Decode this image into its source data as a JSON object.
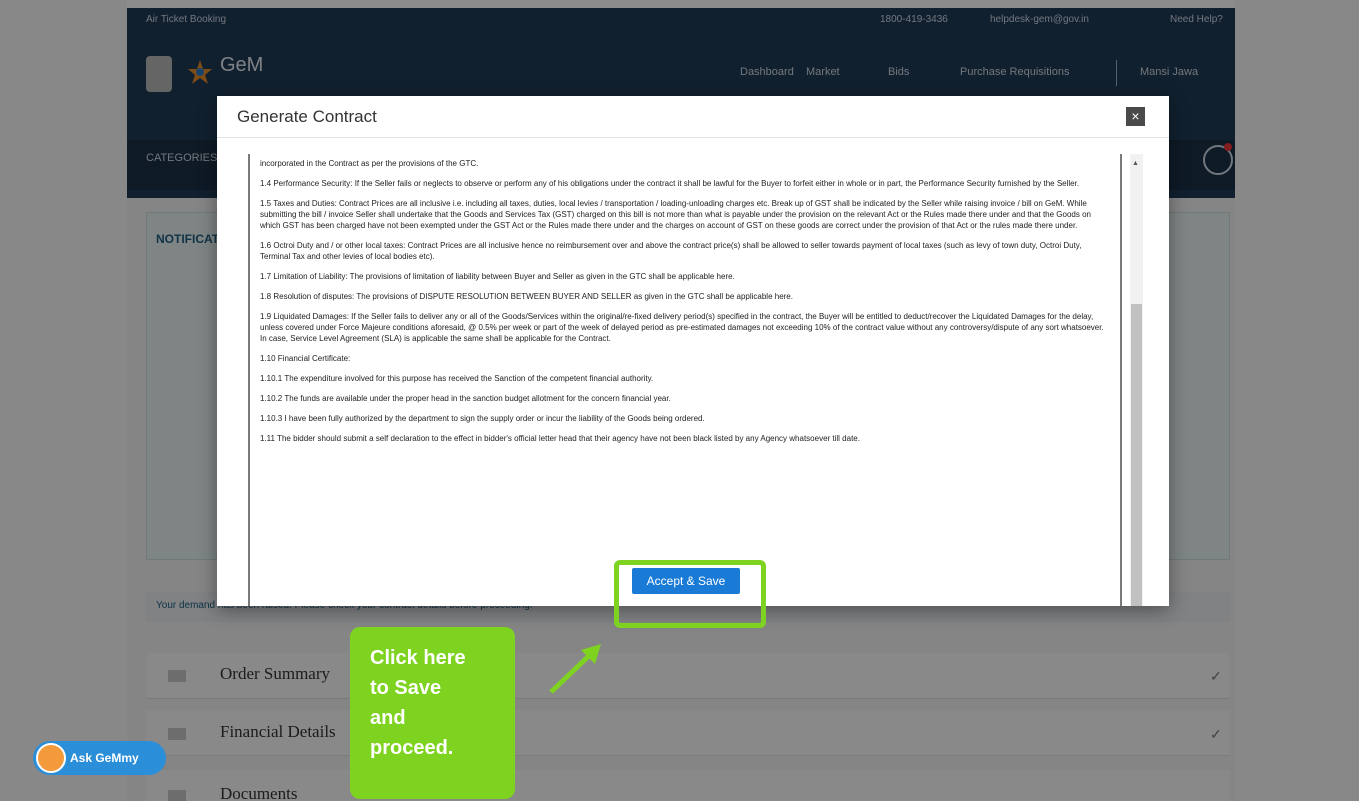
{
  "topbar": {
    "booking_label": "Air Ticket Booking",
    "phone": "1800-419-3436",
    "email": "helpdesk-gem@gov.in",
    "help_label": "Need Help?"
  },
  "header": {
    "logo_text": "GeM",
    "nav": [
      "Dashboard",
      "Market",
      "Bids",
      "Purchase Requisitions"
    ],
    "user_name": "Mansi Jawa",
    "categories_label": "CATEGORIES"
  },
  "background": {
    "notice_title": "NOTIFICATIONS",
    "info_strip": "Your demand has been raised. Please check your contract details before proceeding.",
    "accordion": [
      "Order Summary",
      "Financial Details",
      "Documents"
    ]
  },
  "modal": {
    "title": "Generate Contract",
    "close_label": "×",
    "terms": [
      "incorporated in the Contract as per the provisions of the GTC.",
      "1.4 Performance Security: If the Seller fails or neglects to observe or perform any of his obligations under the contract it shall be lawful for the Buyer to forfeit either in whole or in part, the Performance Security furnished by the Seller.",
      "1.5 Taxes and Duties: Contract Prices are all inclusive i.e. including all taxes, duties, local levies / transportation / loading-unloading charges etc. Break up of GST shall be indicated by the Seller while raising invoice / bill on GeM. While submitting the bill / invoice Seller shall undertake that the Goods and Services Tax (GST) charged on this bill is not more than what is payable under the provision on the relevant Act or the Rules made there under and that the Goods on which GST has been charged have not been exempted under the GST Act or the Rules made there under and the charges on account of GST on these goods are correct under the provision of that Act or the rules made there under.",
      "1.6 Octroi Duty and / or other local taxes: Contract Prices are all inclusive hence no reimbursement over and above the contract price(s) shall be allowed to seller towards payment of local taxes (such as levy of town duty, Octroi Duty, Terminal Tax and other levies of local bodies etc).",
      "1.7 Limitation of Liability: The provisions of limitation of liability between Buyer and Seller as given in the GTC shall be applicable here.",
      "1.8 Resolution of disputes: The provisions of DISPUTE RESOLUTION BETWEEN BUYER AND SELLER as given in the GTC shall be applicable here.",
      "1.9 Liquidated Damages: If the Seller fails to deliver any or all of the Goods/Services within the original/re-fixed delivery period(s) specified in the contract, the Buyer will be entitled to deduct/recover the Liquidated Damages for the delay, unless covered under Force Majeure conditions aforesaid, @ 0.5% per week or part of the week of delayed period as pre-estimated damages not exceeding 10% of the contract value without any controversy/dispute of any sort whatsoever. In case, Service Level Agreement (SLA) is applicable the same shall be applicable for the Contract.",
      "1.10 Financial Certificate:",
      "1.10.1 The expenditure involved for this purpose has received the Sanction of the competent financial authority.",
      "1.10.2 The funds are available under the proper head in the sanction budget allotment for the concern financial year.",
      "1.10.3 I have been fully authorized by the department to sign the supply order or incur the liability of the Goods being ordered.",
      "1.11 The bidder should submit a self declaration to the effect in bidder's official letter head that their agency have not been black listed by any Agency whatsoever till date."
    ],
    "accept_label": "Accept & Save"
  },
  "callout": {
    "lines": [
      "Click here",
      "to Save",
      "and",
      "proceed."
    ]
  },
  "chat": {
    "label": "Ask GeMmy"
  },
  "colors": {
    "header_bg": "#1f3b57",
    "accent_green": "#7ed321",
    "button_blue": "#1a7bd6"
  }
}
